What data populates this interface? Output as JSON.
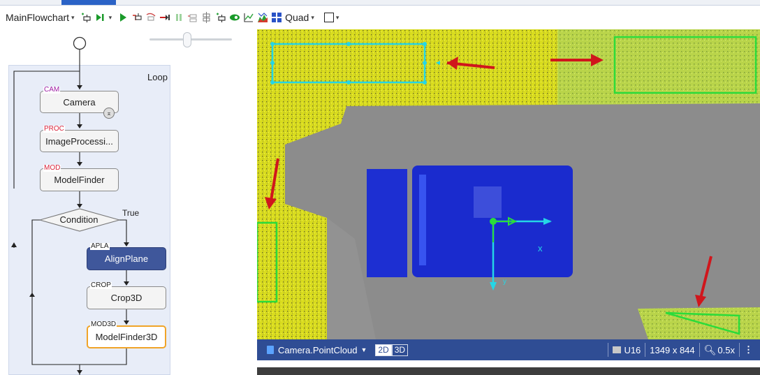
{
  "toolbar": {
    "flowchart_name": "MainFlowchart",
    "layout_label": "Quad"
  },
  "flowchart": {
    "loop_label": "Loop",
    "true_label": "True",
    "nodes": [
      {
        "tag": "CAM",
        "label": "Camera"
      },
      {
        "tag": "PROC",
        "label": "ImageProcessi..."
      },
      {
        "tag": "MOD",
        "label": "ModelFinder"
      },
      {
        "tag": "",
        "label": "Condition"
      },
      {
        "tag": "APLA",
        "label": "AlignPlane"
      },
      {
        "tag": "CROP",
        "label": "Crop3D"
      },
      {
        "tag": "MOD3D",
        "label": "ModelFinder3D"
      }
    ]
  },
  "viewer": {
    "source": "Camera.PointCloud",
    "mode_2d": "2D",
    "mode_3d": "3D",
    "pixel_type": "U16",
    "resolution": "1349 x 844",
    "zoom": "0.5x",
    "axis_x": "x",
    "axis_y": "y"
  },
  "colors": {
    "accent": "#2f4d94",
    "selected_node": "#3f579b",
    "highlight_node": "#f0a428",
    "roi_cyan": "#25d6e6",
    "roi_green": "#2bdc3a",
    "arrow_red": "#d0161c",
    "points_yellow": "#dfe21c",
    "part_blue": "#1a2fd6"
  }
}
